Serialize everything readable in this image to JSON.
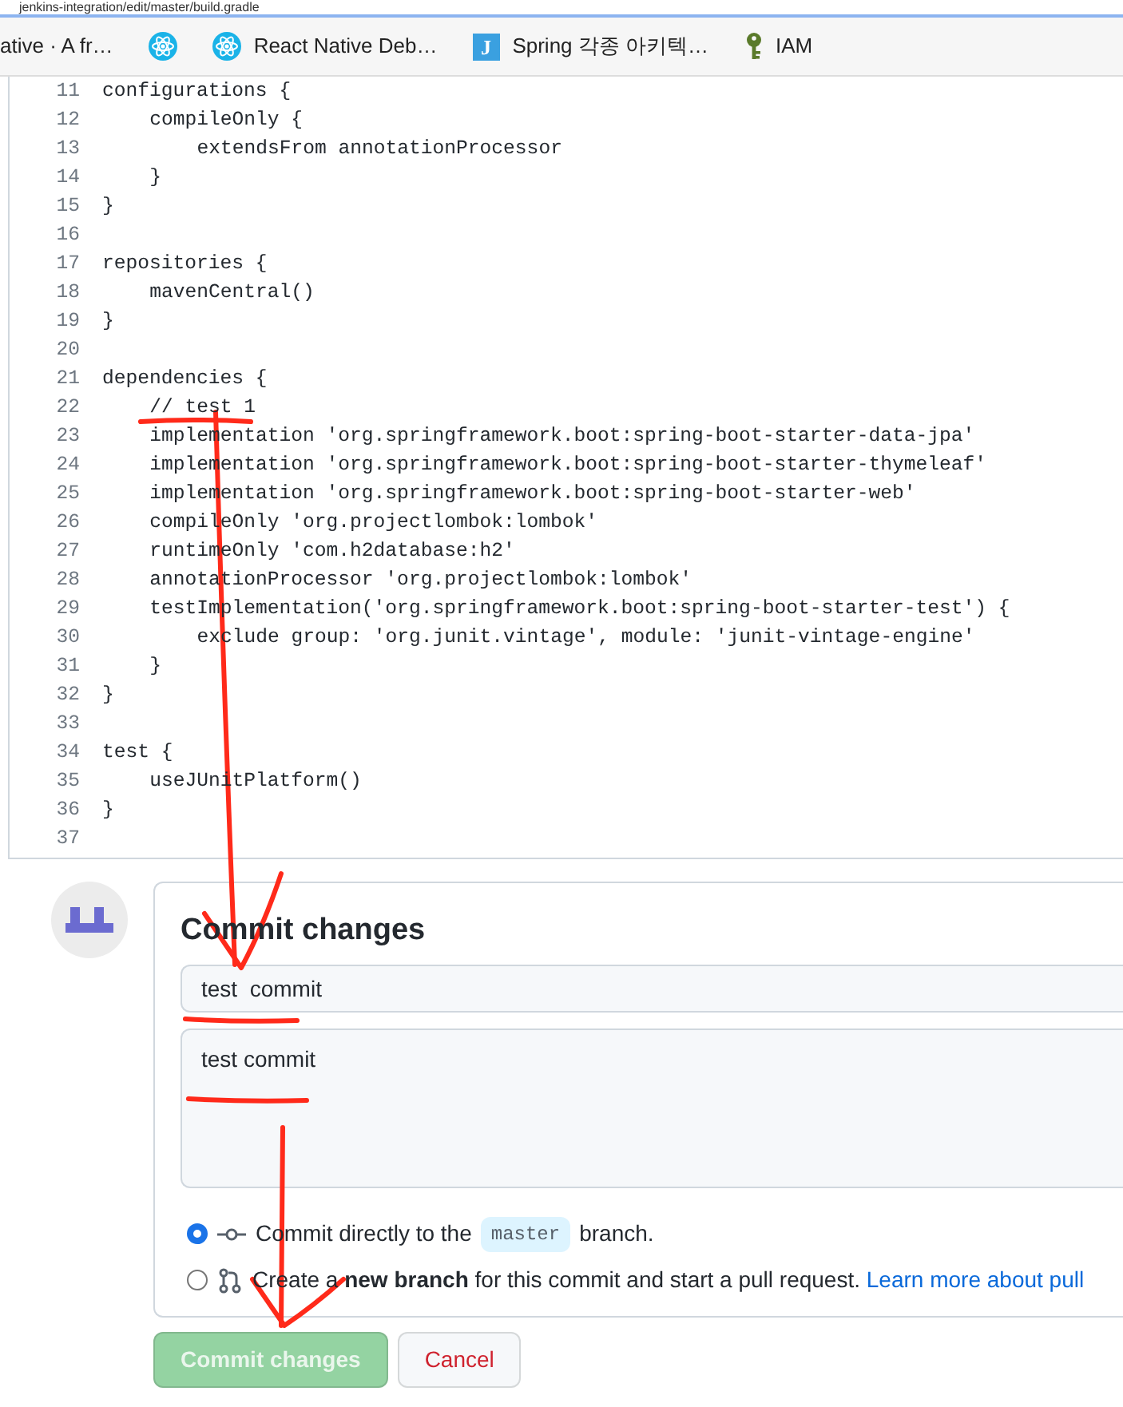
{
  "browser": {
    "address": "jenkins-integration/edit/master/build.gradle",
    "bookmarks": [
      {
        "label": "ative · A fr…",
        "kind": "none"
      },
      {
        "kind": "react"
      },
      {
        "label": "React Native Deb…",
        "kind": "react"
      },
      {
        "label": "Spring 각종 아키텍…",
        "kind": "letter",
        "letter": "J"
      },
      {
        "label": "IAM",
        "kind": "key"
      }
    ]
  },
  "editor": {
    "lines": [
      {
        "number": "11",
        "text": "configurations {"
      },
      {
        "number": "12",
        "text": "    compileOnly {"
      },
      {
        "number": "13",
        "text": "        extendsFrom annotationProcessor"
      },
      {
        "number": "14",
        "text": "    }"
      },
      {
        "number": "15",
        "text": "}"
      },
      {
        "number": "16"
      },
      {
        "number": "17",
        "text": "repositories {"
      },
      {
        "number": "18",
        "text": "    mavenCentral()"
      },
      {
        "number": "19",
        "text": "}"
      },
      {
        "number": "20"
      },
      {
        "number": "21",
        "text": "dependencies {"
      },
      {
        "number": "22",
        "text": "    // test 1"
      },
      {
        "number": "23",
        "text": "    implementation 'org.springframework.boot:spring-boot-starter-data-jpa'"
      },
      {
        "number": "24",
        "text": "    implementation 'org.springframework.boot:spring-boot-starter-thymeleaf'"
      },
      {
        "number": "25",
        "text": "    implementation 'org.springframework.boot:spring-boot-starter-web'"
      },
      {
        "number": "26",
        "text": "    compileOnly 'org.projectlombok:lombok'"
      },
      {
        "number": "27",
        "text": "    runtimeOnly 'com.h2database:h2'"
      },
      {
        "number": "28",
        "text": "    annotationProcessor 'org.projectlombok:lombok'"
      },
      {
        "number": "29",
        "text": "    testImplementation('org.springframework.boot:spring-boot-starter-test') {"
      },
      {
        "number": "30",
        "text": "        exclude group: 'org.junit.vintage', module: 'junit-vintage-engine'"
      },
      {
        "number": "31",
        "text": "    }"
      },
      {
        "number": "32",
        "text": "}"
      },
      {
        "number": "33"
      },
      {
        "number": "34",
        "text": "test {"
      },
      {
        "number": "35",
        "text": "    useJUnitPlatform()"
      },
      {
        "number": "36",
        "text": "}"
      },
      {
        "number": "37"
      }
    ]
  },
  "commit": {
    "title": "Commit changes",
    "summary": "test  commit",
    "description": "test commit",
    "options": [
      {
        "kind": "direct",
        "selected": true,
        "text_before": "Commit directly to the",
        "branch": "master",
        "text_after": "branch."
      },
      {
        "kind": "new_branch",
        "selected": false,
        "text": "Create a **new branch** for this commit and start a pull request.",
        "link": "Learn more about pull"
      }
    ],
    "buttons": [
      {
        "label": "Commit changes",
        "kind": "primary",
        "disabled": true
      },
      {
        "label": "Cancel",
        "kind": "cancel"
      }
    ]
  }
}
